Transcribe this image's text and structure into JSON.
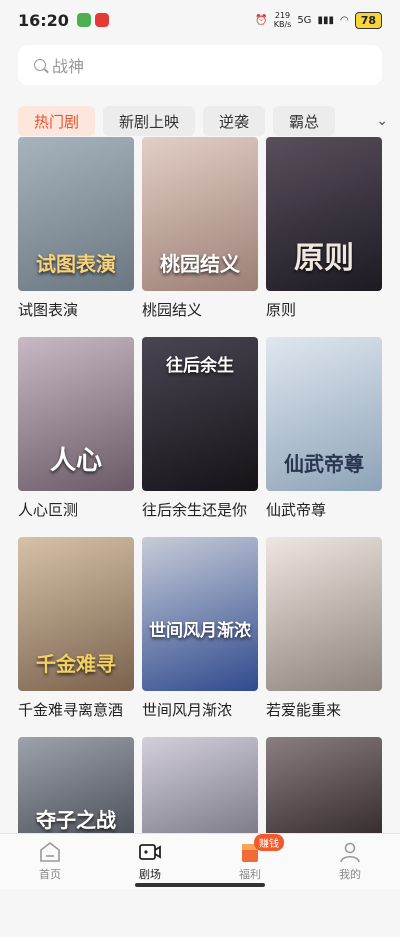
{
  "status": {
    "time": "16:20",
    "net_speed": "219",
    "net_unit": "KB/s",
    "signal": "5G",
    "battery": "78"
  },
  "search": {
    "placeholder": "战神"
  },
  "tabs": [
    {
      "label": "热门剧",
      "active": true
    },
    {
      "label": "新剧上映",
      "active": false
    },
    {
      "label": "逆袭",
      "active": false
    },
    {
      "label": "霸总",
      "active": false
    }
  ],
  "dramas": [
    {
      "title": "试图表演",
      "poster_text": "试图表演",
      "color": "#7a8a96"
    },
    {
      "title": "桃园结义",
      "poster_text": "桃园结义",
      "color": "#c9a79a"
    },
    {
      "title": "原则",
      "poster_text": "原则",
      "color": "#3b3440"
    },
    {
      "title": "人心叵测",
      "poster_text": "人心",
      "color": "#8c7a86"
    },
    {
      "title": "往后余生还是你",
      "poster_text": "往后余生",
      "color": "#2c2a33"
    },
    {
      "title": "仙武帝尊",
      "poster_text": "仙武帝尊",
      "color": "#9fb2c6"
    },
    {
      "title": "千金难寻离意酒",
      "poster_text": "千金难寻",
      "color": "#a08770"
    },
    {
      "title": "世间风月渐浓",
      "poster_text": "世间风月渐浓",
      "color": "#4a63a6"
    },
    {
      "title": "若爱能重来",
      "poster_text": "",
      "color": "#b4a8a2"
    },
    {
      "title": "",
      "poster_text": "夺子之战",
      "color": "#6b6f7a"
    },
    {
      "title": "",
      "poster_text": "",
      "color": "#a9a6b4"
    },
    {
      "title": "",
      "poster_text": "",
      "color": "#5d5356"
    }
  ],
  "nav": [
    {
      "label": "首页",
      "icon": "home-icon",
      "active": false
    },
    {
      "label": "剧场",
      "icon": "theater-icon",
      "active": true
    },
    {
      "label": "福利",
      "icon": "gift-icon",
      "active": false,
      "badge": "赚钱"
    },
    {
      "label": "我的",
      "icon": "profile-icon",
      "active": false
    }
  ],
  "colors": {
    "accent": "#e8532c",
    "tab_active_bg": "#fde6dc"
  }
}
